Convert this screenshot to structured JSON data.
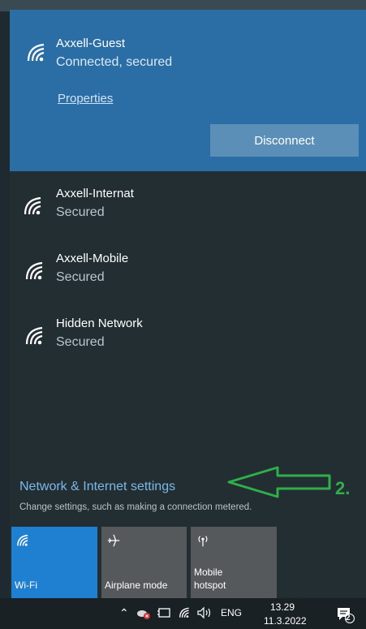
{
  "connected_network": {
    "name": "Axxell-Guest",
    "status": "Connected, secured",
    "properties_label": "Properties",
    "disconnect_label": "Disconnect"
  },
  "networks": [
    {
      "name": "Axxell-Internat",
      "status": "Secured"
    },
    {
      "name": "Axxell-Mobile",
      "status": "Secured"
    },
    {
      "name": "Hidden Network",
      "status": "Secured"
    }
  ],
  "settings": {
    "link_label": "Network & Internet settings",
    "description": "Change settings, such as making a connection metered."
  },
  "annotation": {
    "label": "2."
  },
  "quick_actions": {
    "wifi": {
      "label": "Wi-Fi",
      "icon": "wifi-icon",
      "active": true
    },
    "airplane": {
      "label": "Airplane mode",
      "icon": "airplane-icon",
      "active": false
    },
    "hotspot": {
      "label_line1": "Mobile",
      "label_line2": "hotspot",
      "icon": "hotspot-icon",
      "active": false
    }
  },
  "taskbar": {
    "language": "ENG",
    "time": "13.29",
    "date": "11.3.2022",
    "notification_count": "2"
  },
  "colors": {
    "accent": "#2b6ea6",
    "tile_active": "#1f7fd1",
    "annotation_green": "#2fae4a",
    "link": "#7ab8e8"
  }
}
